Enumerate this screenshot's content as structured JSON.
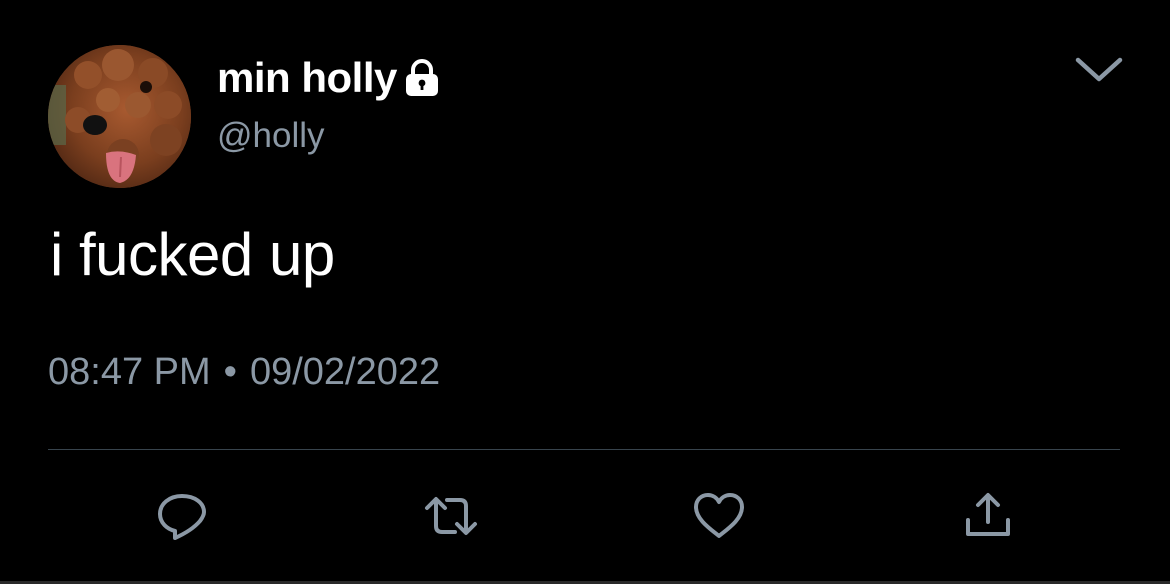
{
  "user": {
    "display_name": "min holly",
    "handle": "@holly",
    "protected_icon": "lock-icon",
    "avatar": "avatar-photo"
  },
  "tweet": {
    "text": "i fucked up",
    "time": "08:47 PM",
    "separator": "•",
    "date": "09/02/2022"
  },
  "actions": {
    "reply_icon": "reply-icon",
    "retweet_icon": "retweet-icon",
    "like_icon": "heart-icon",
    "share_icon": "share-icon",
    "more_icon": "chevron-down-icon"
  },
  "colors": {
    "background": "#000000",
    "primary_text": "#ffffff",
    "secondary_text": "#8b98a5",
    "divider": "#38444d",
    "icon": "#8b98a5"
  }
}
